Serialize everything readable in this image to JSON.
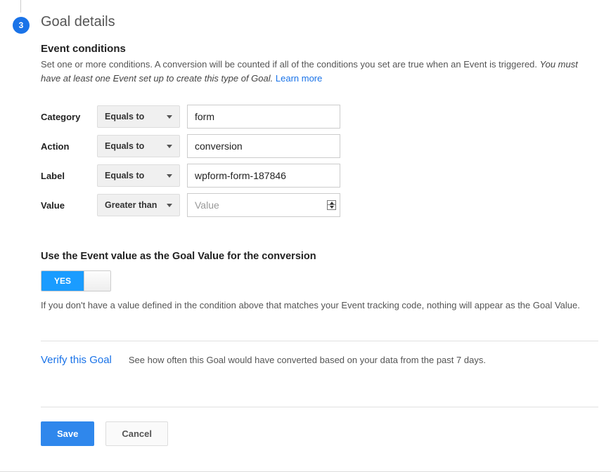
{
  "step": {
    "number": "3",
    "title": "Goal details"
  },
  "section1": {
    "heading": "Event conditions",
    "desc_text": "Set one or more conditions. A conversion will be counted if all of the conditions you set are true when an Event is triggered. ",
    "desc_italic": "You must have at least one Event set up to create this type of Goal. ",
    "learn_more": "Learn more"
  },
  "conditions": {
    "rows": [
      {
        "label": "Category",
        "operator": "Equals to",
        "value": "form",
        "placeholder": "",
        "type": "text"
      },
      {
        "label": "Action",
        "operator": "Equals to",
        "value": "conversion",
        "placeholder": "",
        "type": "text"
      },
      {
        "label": "Label",
        "operator": "Equals to",
        "value": "wpform-form-187846",
        "placeholder": "",
        "type": "text"
      },
      {
        "label": "Value",
        "operator": "Greater than",
        "value": "",
        "placeholder": "Value",
        "type": "number"
      }
    ]
  },
  "section2": {
    "heading": "Use the Event value as the Goal Value for the conversion",
    "toggle_label": "YES",
    "help": "If you don't have a value defined in the condition above that matches your Event tracking code, nothing will appear as the Goal Value."
  },
  "verify": {
    "link": "Verify this Goal",
    "desc": "See how often this Goal would have converted based on your data from the past 7 days."
  },
  "buttons": {
    "save": "Save",
    "cancel": "Cancel"
  }
}
